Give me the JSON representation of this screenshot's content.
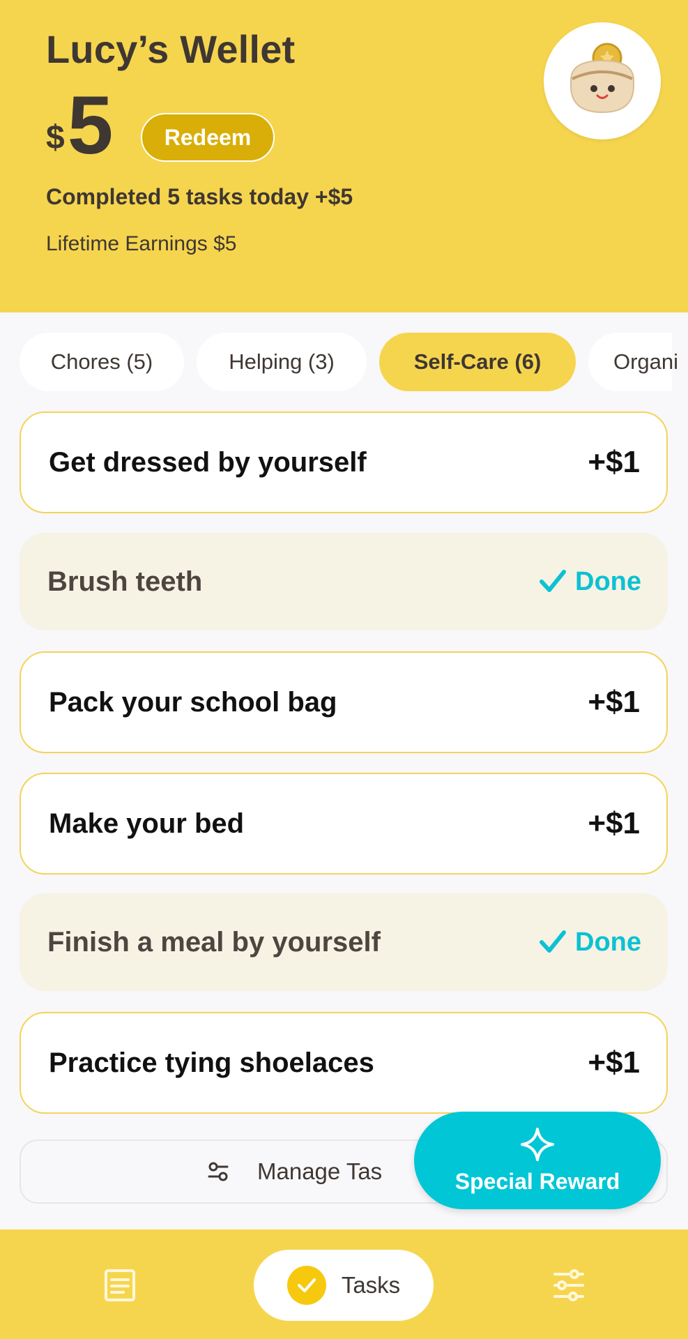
{
  "header": {
    "title": "Lucy’s Wellet",
    "currency_symbol": "$",
    "balance": "5",
    "redeem_label": "Redeem",
    "today_summary": "Completed 5 tasks today +$5",
    "lifetime": "Lifetime Earnings $5",
    "avatar_icon": "coin-purse-icon"
  },
  "tabs": [
    {
      "label": "Chores (5)",
      "active": false
    },
    {
      "label": "Helping (3)",
      "active": false
    },
    {
      "label": "Self-Care (6)",
      "active": true
    },
    {
      "label": "Organi",
      "active": false
    }
  ],
  "tasks": [
    {
      "name": "Get dressed by yourself",
      "status": "todo",
      "reward": "+$1"
    },
    {
      "name": "Brush teeth",
      "status": "done",
      "done_label": "Done"
    },
    {
      "name": "Pack your school bag",
      "status": "todo",
      "reward": "+$1"
    },
    {
      "name": "Make your bed",
      "status": "todo",
      "reward": "+$1"
    },
    {
      "name": "Finish a meal by yourself",
      "status": "done",
      "done_label": "Done"
    },
    {
      "name": "Practice tying shoelaces",
      "status": "todo",
      "reward": "+$1"
    }
  ],
  "manage": {
    "label": "Manage Tas",
    "icon": "sliders-icon"
  },
  "fab": {
    "label": "Special Reward",
    "icon": "sparkle-icon"
  },
  "nav": {
    "left_icon": "list-icon",
    "center_label": "Tasks",
    "center_icon": "check-circle-icon",
    "right_icon": "settings-sliders-icon"
  },
  "colors": {
    "brand_yellow": "#F6D54E",
    "redeem": "#D9AE08",
    "accent_teal": "#00C6D6",
    "done_bg": "#F6F3E5"
  }
}
